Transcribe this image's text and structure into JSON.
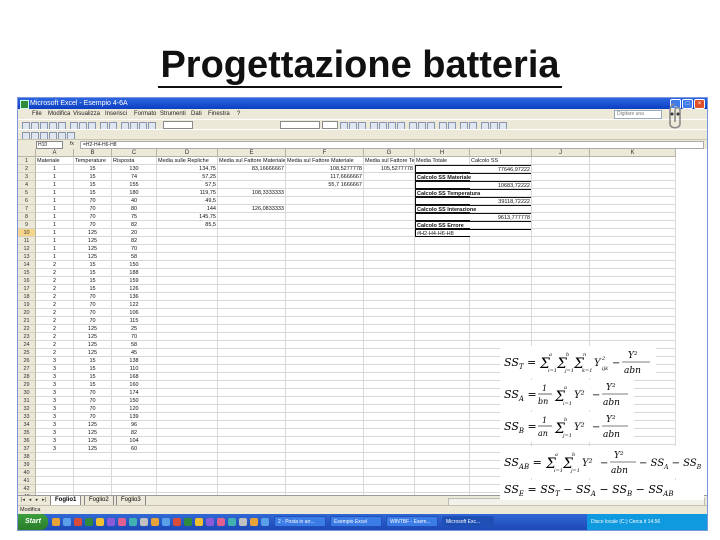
{
  "slide": {
    "title": "Progettazione batteria"
  },
  "window": {
    "title": "Microsoft Excel - Esempio 4-6A"
  },
  "menubar": {
    "items": [
      "File",
      "Modifica",
      "Visualizza",
      "Inserisci",
      "Formato",
      "Strumenti",
      "Dati",
      "Finestra",
      "?"
    ],
    "help_placeholder": "Digitare una domanda"
  },
  "formula_bar": {
    "name_box": "H10",
    "fx": "fx",
    "formula": "=H2-H4-H6-H8"
  },
  "columns": [
    "A",
    "B",
    "C",
    "D",
    "E",
    "F",
    "G",
    "H",
    "I",
    "J",
    "K"
  ],
  "headers": [
    "Materiale",
    "Temperature",
    "Risposta",
    "Media sulle Repliche",
    "Media sul Fattore Materiale",
    "Media sul Fattore Materiale",
    "Media sul Fattore Temperatura",
    "Media Totale",
    "Calcolo SS"
  ],
  "rows": [
    [
      "1",
      "15",
      "130",
      "134,75",
      "83,16666667",
      "",
      "",
      "",
      ""
    ],
    [
      "1",
      "15",
      "74",
      "57,25",
      "",
      "",
      "",
      "",
      ""
    ],
    [
      "1",
      "15",
      "155",
      "57,5",
      "",
      "",
      "",
      "",
      ""
    ],
    [
      "1",
      "15",
      "180",
      "",
      "",
      "",
      "",
      "",
      ""
    ],
    [
      "1",
      "70",
      "40",
      "",
      "",
      "",
      "",
      "",
      ""
    ],
    [
      "1",
      "70",
      "80",
      "",
      "",
      "",
      "",
      "",
      ""
    ],
    [
      "1",
      "70",
      "75",
      "",
      "",
      "",
      "",
      "",
      ""
    ],
    [
      "1",
      "70",
      "82",
      "",
      "",
      "",
      "",
      "",
      ""
    ],
    [
      "1",
      "125",
      "20",
      "",
      "",
      "",
      "",
      "",
      ""
    ],
    [
      "1",
      "125",
      "82",
      "",
      "",
      "",
      "",
      "",
      ""
    ],
    [
      "1",
      "125",
      "70",
      "",
      "",
      "",
      "",
      "",
      ""
    ],
    [
      "1",
      "125",
      "58",
      "",
      "",
      "",
      "",
      "",
      ""
    ],
    [
      "2",
      "15",
      "150",
      "",
      "",
      "",
      "",
      "",
      ""
    ],
    [
      "2",
      "15",
      "188",
      "",
      "",
      "",
      "",
      "",
      ""
    ],
    [
      "2",
      "15",
      "159",
      "",
      "",
      "",
      "",
      "",
      ""
    ],
    [
      "2",
      "15",
      "126",
      "",
      "",
      "",
      "",
      "",
      ""
    ],
    [
      "2",
      "70",
      "136",
      "",
      "",
      "",
      "",
      "",
      ""
    ],
    [
      "2",
      "70",
      "122",
      "",
      "",
      "",
      "",
      "",
      ""
    ],
    [
      "2",
      "70",
      "106",
      "",
      "",
      "",
      "",
      "",
      ""
    ],
    [
      "2",
      "70",
      "115",
      "",
      "",
      "",
      "",
      "",
      ""
    ],
    [
      "2",
      "125",
      "25",
      "",
      "",
      "",
      "",
      "",
      ""
    ],
    [
      "2",
      "125",
      "70",
      "",
      "",
      "",
      "",
      "",
      ""
    ],
    [
      "2",
      "125",
      "58",
      "",
      "",
      "",
      "",
      "",
      ""
    ],
    [
      "2",
      "125",
      "45",
      "",
      "",
      "",
      "",
      "",
      ""
    ],
    [
      "3",
      "15",
      "138",
      "",
      "",
      "",
      "",
      "",
      ""
    ],
    [
      "3",
      "15",
      "110",
      "",
      "",
      "",
      "",
      "",
      ""
    ],
    [
      "3",
      "15",
      "168",
      "",
      "",
      "",
      "",
      "",
      ""
    ],
    [
      "3",
      "15",
      "160",
      "",
      "",
      "",
      "",
      "",
      ""
    ],
    [
      "3",
      "70",
      "174",
      "",
      "",
      "",
      "",
      "",
      ""
    ],
    [
      "3",
      "70",
      "150",
      "",
      "",
      "",
      "",
      "",
      ""
    ],
    [
      "3",
      "70",
      "120",
      "",
      "",
      "",
      "",
      "",
      ""
    ],
    [
      "3",
      "70",
      "139",
      "",
      "",
      "",
      "",
      "",
      ""
    ],
    [
      "3",
      "125",
      "96",
      "",
      "",
      "",
      "",
      "",
      ""
    ],
    [
      "3",
      "125",
      "82",
      "",
      "",
      "",
      "",
      "",
      ""
    ],
    [
      "3",
      "125",
      "104",
      "",
      "",
      "",
      "",
      "",
      ""
    ],
    [
      "3",
      "125",
      "60",
      "",
      "",
      "",
      "",
      "",
      ""
    ]
  ],
  "colD_extra": [
    "134,75",
    "57,25",
    "57,5",
    "119,75",
    "49,5",
    "144",
    "145,75",
    "85,5"
  ],
  "colE_extra": [
    "83,16666667",
    "",
    "",
    "",
    "",
    "126,0833333",
    "",
    ""
  ],
  "colE_row5": "108,3333333",
  "colF_values": [
    "108,5277778",
    "117,6666667",
    "55,7 1666667"
  ],
  "colG_values": [
    "105,5277778"
  ],
  "ss_labels": [
    "Calcolo SS_T",
    "Calcolo SS Materiale",
    "Calcolo SS Temperatura",
    "Calcolo SS Interazione",
    "Calcolo SS Errore"
  ],
  "ss_values": [
    "77646,97222",
    "10683,72222",
    "39118,72222",
    "9613,777778",
    "#H2-H4-H6-H8"
  ],
  "sheets": [
    "Foglio1",
    "Foglio2",
    "Foglio3"
  ],
  "status": "Modifica",
  "taskbar": {
    "start": "Start",
    "tasks": [
      "2 - Posta in arr...",
      "Esempio Excel",
      "WINTBF - Esem...",
      "Microsoft Exc..."
    ],
    "tray": "Disco locale (C:)  Cerca  it  14.56"
  },
  "formulas": {
    "sst": "SS_T = Σ_i=1..a Σ_j=1..b Σ_k=1..n Y²_ijk − Y²... / abn",
    "ssa": "SS_A = 1/bn Σ_i=1..a Y²_i.. − Y²... / abn",
    "ssb": "SS_B = 1/an Σ_j=1..b Y²_.j. − Y²... / abn",
    "ssab": "SS_AB = Σ_i=1..a Σ_j=1..b Y²_ij. − Y²... / abn − SS_A − SS_B",
    "sse": "SS_E = SS_T − SS_A − SS_B − SS_AB"
  }
}
